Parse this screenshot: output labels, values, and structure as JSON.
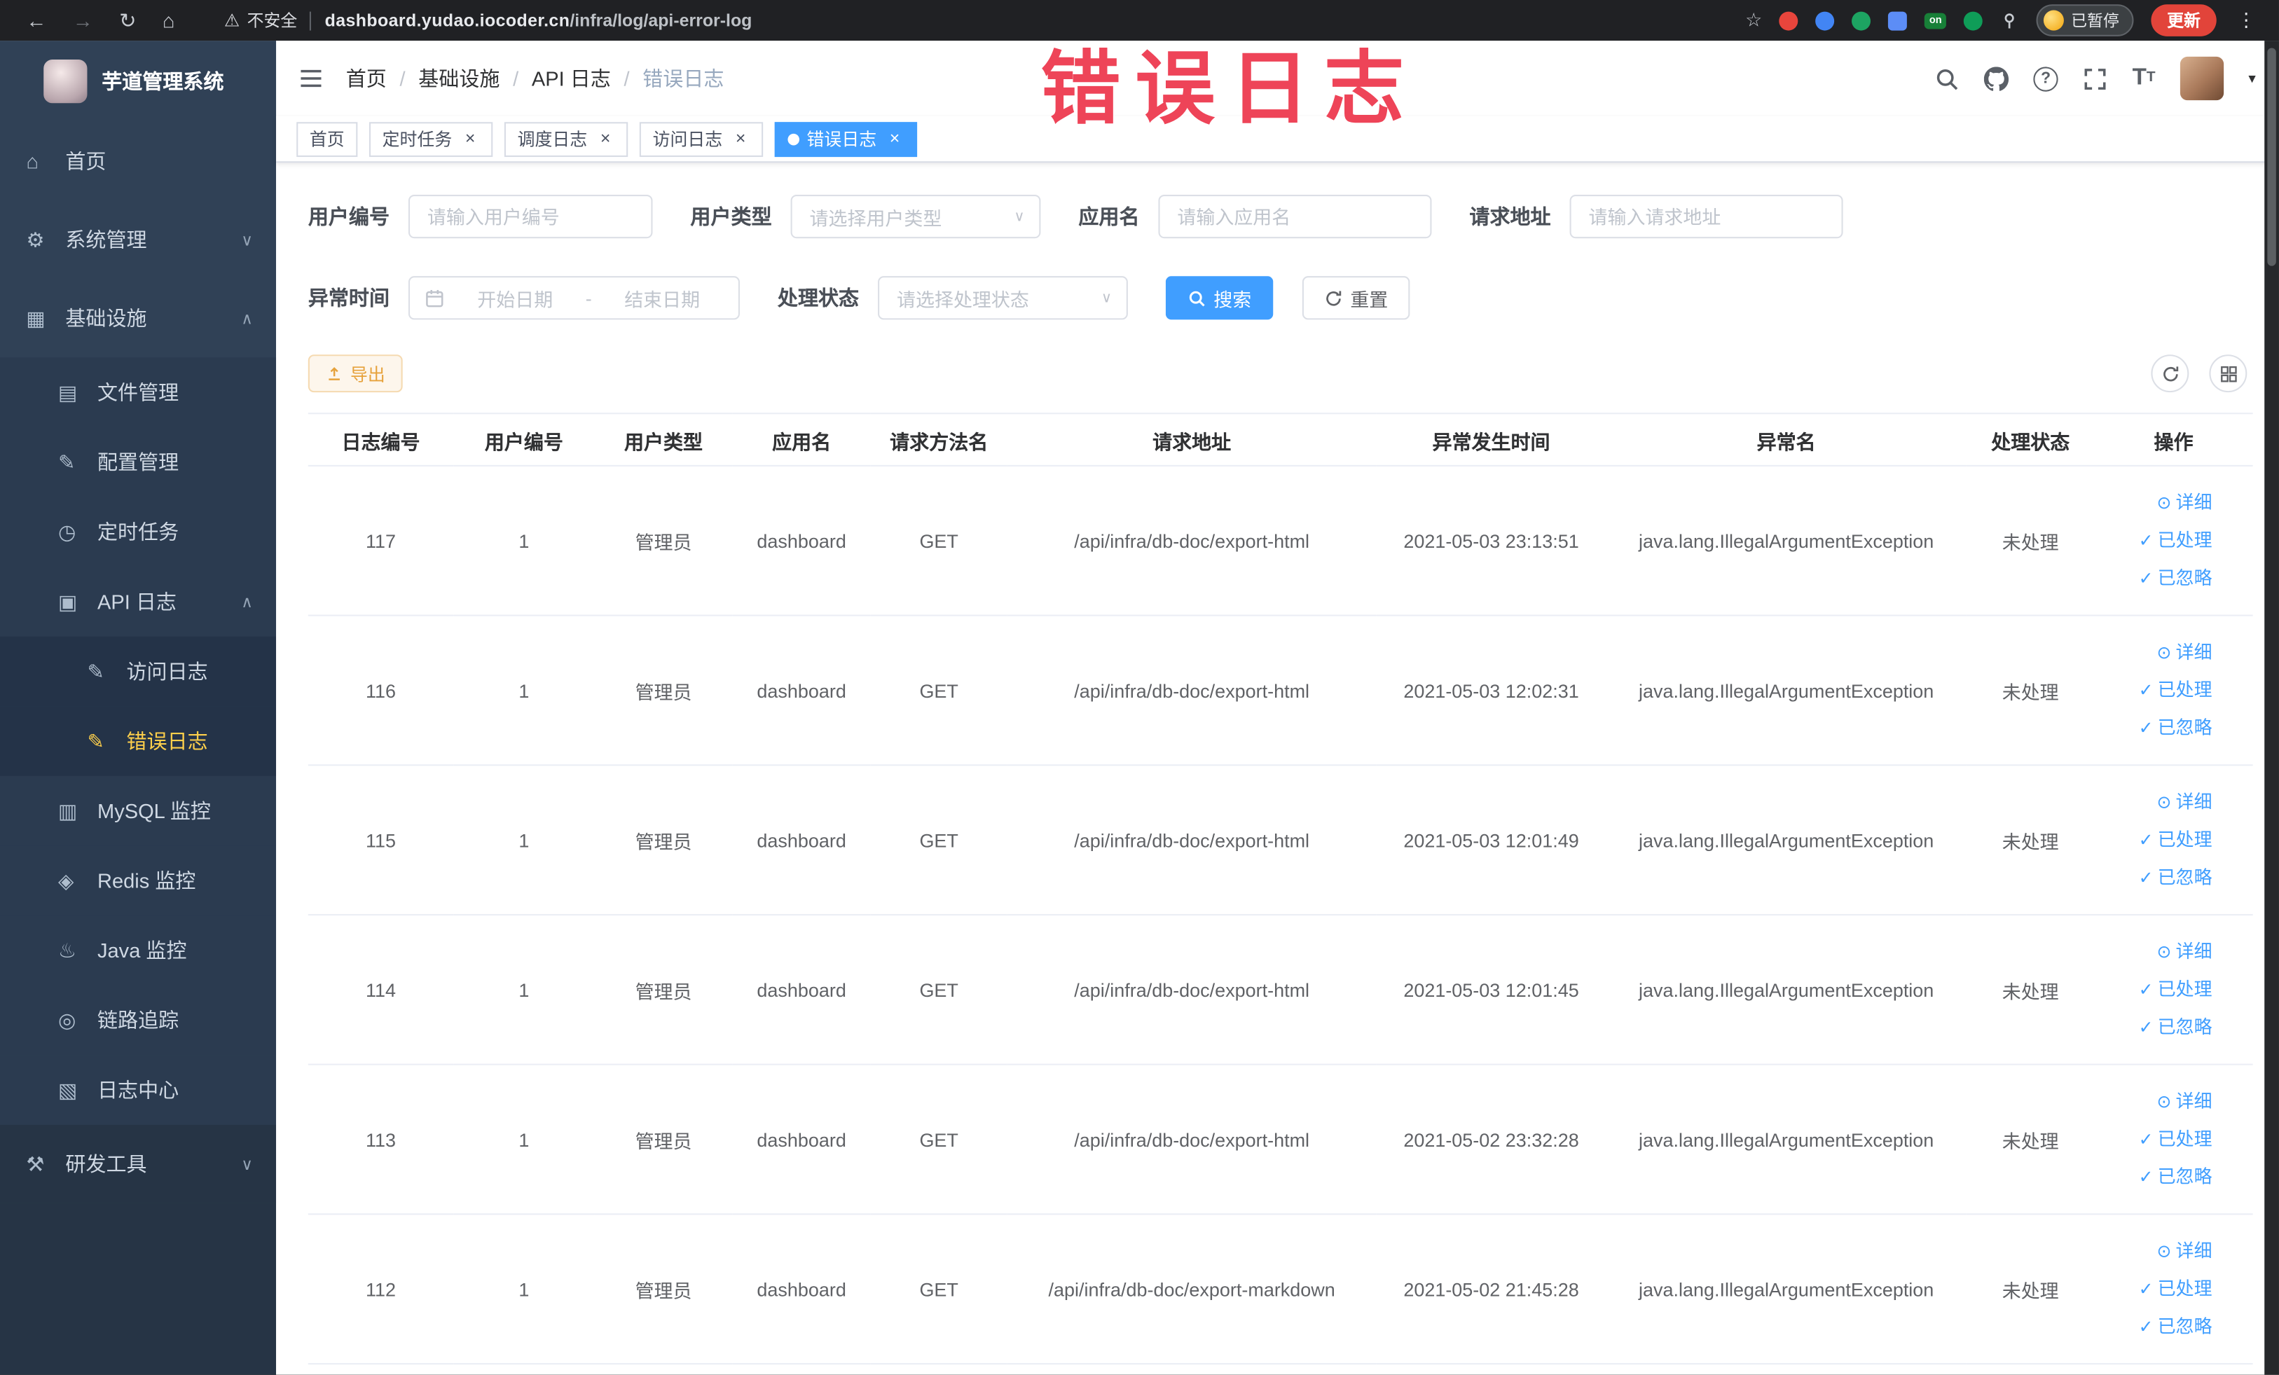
{
  "theme": {
    "primary": "#409eff",
    "warning": "#e6a23c",
    "sidebar_active": "#ffd04b",
    "annotation": "#ee4458"
  },
  "browser": {
    "security_label": "不安全",
    "url_domain": "dashboard.yudao.iocoder.cn",
    "url_path": "/infra/log/api-error-log",
    "paused_label": "已暂停",
    "update_label": "更新"
  },
  "annotation": {
    "text": "错误日志"
  },
  "sidebar": {
    "title": "芋道管理系统",
    "items": [
      {
        "label": "首页",
        "icon": "home-icon",
        "level": 1
      },
      {
        "label": "系统管理",
        "icon": "gear-icon",
        "level": 1,
        "chevron": "down"
      },
      {
        "label": "基础设施",
        "icon": "infrastructure-icon",
        "level": 1,
        "chevron": "up"
      },
      {
        "label": "文件管理",
        "icon": "file-icon",
        "level": 2
      },
      {
        "label": "配置管理",
        "icon": "config-icon",
        "level": 2
      },
      {
        "label": "定时任务",
        "icon": "timer-icon",
        "level": 2
      },
      {
        "label": "API 日志",
        "icon": "api-log-icon",
        "level": 2,
        "chevron": "up"
      },
      {
        "label": "访问日志",
        "icon": "access-log-icon",
        "level": 3
      },
      {
        "label": "错误日志",
        "icon": "error-log-icon",
        "level": 3,
        "active": true
      },
      {
        "label": "MySQL 监控",
        "icon": "mysql-icon",
        "level": 2
      },
      {
        "label": "Redis 监控",
        "icon": "redis-icon",
        "level": 2
      },
      {
        "label": "Java 监控",
        "icon": "java-icon",
        "level": 2
      },
      {
        "label": "链路追踪",
        "icon": "trace-icon",
        "level": 2
      },
      {
        "label": "日志中心",
        "icon": "log-center-icon",
        "level": 2
      },
      {
        "label": "研发工具",
        "icon": "devtools-icon",
        "level": 1,
        "chevron": "down",
        "dark": true
      }
    ]
  },
  "breadcrumb": [
    "首页",
    "基础设施",
    "API 日志",
    "错误日志"
  ],
  "tabs": [
    {
      "label": "首页",
      "closable": false,
      "active": false
    },
    {
      "label": "定时任务",
      "closable": true,
      "active": false
    },
    {
      "label": "调度日志",
      "closable": true,
      "active": false
    },
    {
      "label": "访问日志",
      "closable": true,
      "active": false
    },
    {
      "label": "错误日志",
      "closable": true,
      "active": true
    }
  ],
  "filters": {
    "user_id": {
      "label": "用户编号",
      "placeholder": "请输入用户编号"
    },
    "user_type": {
      "label": "用户类型",
      "placeholder": "请选择用户类型"
    },
    "app_name": {
      "label": "应用名",
      "placeholder": "请输入应用名"
    },
    "request_url": {
      "label": "请求地址",
      "placeholder": "请输入请求地址"
    },
    "exception_time": {
      "label": "异常时间",
      "start_placeholder": "开始日期",
      "separator": "-",
      "end_placeholder": "结束日期"
    },
    "process_status": {
      "label": "处理状态",
      "placeholder": "请选择处理状态"
    },
    "search_label": "搜索",
    "reset_label": "重置"
  },
  "toolbar": {
    "export_label": "导出"
  },
  "table": {
    "columns": [
      "日志编号",
      "用户编号",
      "用户类型",
      "应用名",
      "请求方法名",
      "请求地址",
      "异常发生时间",
      "异常名",
      "处理状态",
      "操作"
    ],
    "row_actions": [
      {
        "label": "详细",
        "icon": "eye-icon"
      },
      {
        "label": "已处理",
        "icon": "check-icon"
      },
      {
        "label": "已忽略",
        "icon": "check-icon"
      }
    ],
    "rows": [
      {
        "log_id": "117",
        "user_id": "1",
        "user_type": "管理员",
        "app_name": "dashboard",
        "method": "GET",
        "url": "/api/infra/db-doc/export-html",
        "time": "2021-05-03 23:13:51",
        "exception": "java.lang.IllegalArgumentException",
        "status": "未处理"
      },
      {
        "log_id": "116",
        "user_id": "1",
        "user_type": "管理员",
        "app_name": "dashboard",
        "method": "GET",
        "url": "/api/infra/db-doc/export-html",
        "time": "2021-05-03 12:02:31",
        "exception": "java.lang.IllegalArgumentException",
        "status": "未处理"
      },
      {
        "log_id": "115",
        "user_id": "1",
        "user_type": "管理员",
        "app_name": "dashboard",
        "method": "GET",
        "url": "/api/infra/db-doc/export-html",
        "time": "2021-05-03 12:01:49",
        "exception": "java.lang.IllegalArgumentException",
        "status": "未处理"
      },
      {
        "log_id": "114",
        "user_id": "1",
        "user_type": "管理员",
        "app_name": "dashboard",
        "method": "GET",
        "url": "/api/infra/db-doc/export-html",
        "time": "2021-05-03 12:01:45",
        "exception": "java.lang.IllegalArgumentException",
        "status": "未处理"
      },
      {
        "log_id": "113",
        "user_id": "1",
        "user_type": "管理员",
        "app_name": "dashboard",
        "method": "GET",
        "url": "/api/infra/db-doc/export-html",
        "time": "2021-05-02 23:32:28",
        "exception": "java.lang.IllegalArgumentException",
        "status": "未处理"
      },
      {
        "log_id": "112",
        "user_id": "1",
        "user_type": "管理员",
        "app_name": "dashboard",
        "method": "GET",
        "url": "/api/infra/db-doc/export-markdown",
        "time": "2021-05-02 21:45:28",
        "exception": "java.lang.IllegalArgumentException",
        "status": "未处理"
      }
    ]
  }
}
